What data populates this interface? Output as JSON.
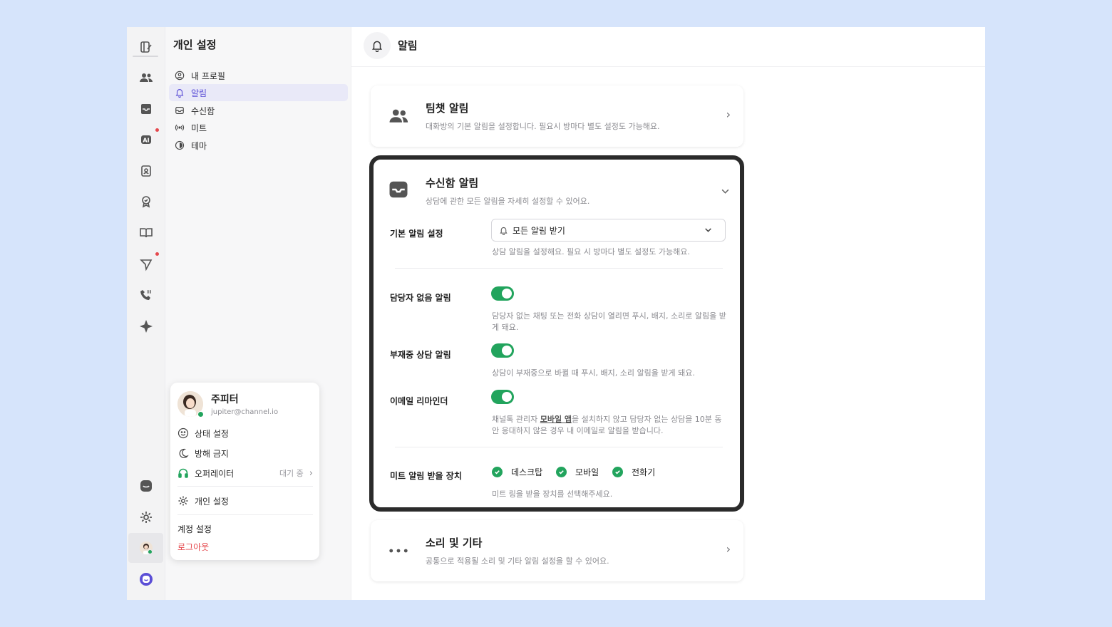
{
  "sidebar": {
    "title": "개인 설정",
    "items": [
      {
        "label": "내 프로필",
        "icon": "profile-icon"
      },
      {
        "label": "알림",
        "icon": "bell-icon",
        "active": true
      },
      {
        "label": "수신함",
        "icon": "inbox-icon"
      },
      {
        "label": "미트",
        "icon": "broadcast-icon"
      },
      {
        "label": "테마",
        "icon": "theme-icon"
      }
    ]
  },
  "popup": {
    "name": "주피터",
    "email": "jupiter@channel.io",
    "status_label": "상태 설정",
    "dnd_label": "방해 금지",
    "operator_label": "오퍼레이터",
    "operator_status": "대기 중",
    "personal_settings_label": "개인 설정",
    "account_settings_label": "계정 설정",
    "logout_label": "로그아웃"
  },
  "header": {
    "title": "알림"
  },
  "cards": {
    "teamchat": {
      "title": "팀챗 알림",
      "subtitle": "대화방의 기본 알림을 설정합니다. 필요시 방마다 별도 설정도 가능해요."
    },
    "inbox": {
      "title": "수신함 알림",
      "subtitle": "상담에 관한 모든 알림을 자세히 설정할 수 있어요.",
      "default_label": "기본 알림 설정",
      "default_value": "모든 알림 받기",
      "default_desc": "상담 알림을 설정해요. 필요 시 방마다 별도 설정도 가능해요.",
      "unassigned_label": "담당자 없음 알림",
      "unassigned_desc": "담당자 없는 채팅 또는 전화 상담이 열리면 푸시, 배지, 소리로 알림을 받게 돼요.",
      "away_label": "부재중 상담 알림",
      "away_desc": "상담이 부재중으로 바뀔 때 푸시, 배지, 소리 알림을 받게 돼요.",
      "email_label": "이메일 리마인더",
      "email_desc_pre": "채널톡 관리자 ",
      "email_desc_link": "모바일 앱",
      "email_desc_post": "을 설치하지 않고 담당자 없는 상담을 10분 동안 응대하지 않은 경우 내 이메일로 알림을 받습니다.",
      "meet_label": "미트 알림 받을 장치",
      "devices": [
        "데스크탑",
        "모바일",
        "전화기"
      ],
      "meet_desc": "미트 링을 받을 장치를 선택해주세요.",
      "toggles": {
        "unassigned": true,
        "away": true,
        "email": true
      }
    },
    "sound": {
      "title": "소리 및 기타",
      "subtitle": "공통으로 적용될 소리 및 기타 알림 설정을 할 수 있어요."
    }
  },
  "colors": {
    "accent": "#5b4ed6",
    "toggle_on": "#22a45d",
    "logout": "#e5484d",
    "background": "#d6e4fb"
  }
}
